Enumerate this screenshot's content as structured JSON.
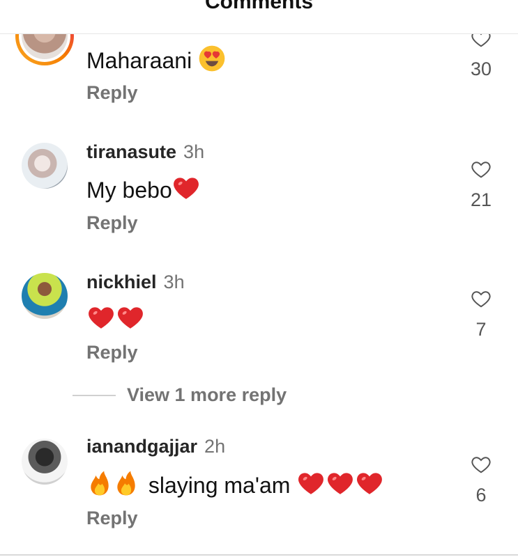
{
  "header": {
    "title": "Comments"
  },
  "comments": [
    {
      "text": "Maharaani",
      "text_emoji": "heart-eyes",
      "reply_label": "Reply",
      "likes": "30"
    },
    {
      "username": "tiranasute",
      "time": "3h",
      "text": "My bebo",
      "text_emoji": "red-heart",
      "reply_label": "Reply",
      "likes": "21"
    },
    {
      "username": "nickhiel",
      "time": "3h",
      "text": "",
      "text_emoji": "red-heart x2",
      "reply_label": "Reply",
      "likes": "7"
    },
    {
      "username": "ianandgajjar",
      "time": "2h",
      "text": "slaying ma'am",
      "text_emoji": "fire x2, red-heart x3",
      "reply_label": "Reply",
      "likes": "6"
    }
  ],
  "view_more_replies": "View 1 more reply",
  "colors": {
    "heart_red": "#e0262b",
    "muted": "#737373",
    "text": "#111111"
  }
}
